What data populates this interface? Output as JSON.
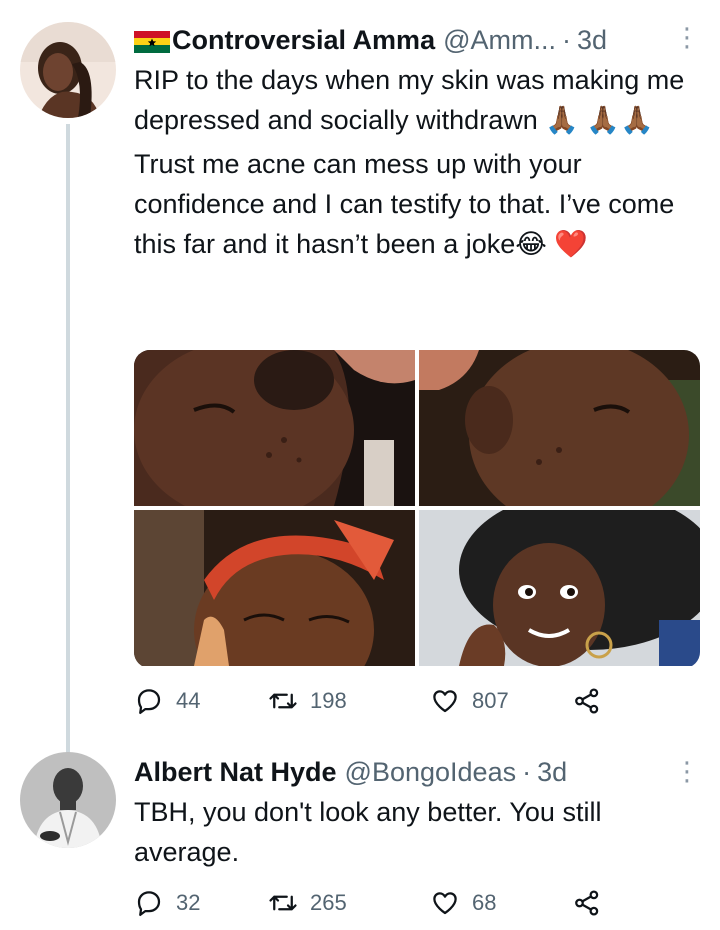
{
  "tweet1": {
    "display_name": "Controversial Amma",
    "handle": "@Amm...",
    "separator": "·",
    "time": "3d",
    "paragraph1": "RIP to the days when my skin was making me depressed and socially withdrawn 🙏🏾 🙏🏾🙏🏾",
    "paragraph2": "Trust me acne can mess up with your confidence and I can testify to that. I’ve come this far and it hasn’t been a joke😂 ❤️",
    "reply_count": "44",
    "retweet_count": "198",
    "like_count": "807",
    "icons": {
      "reply": "reply-icon",
      "retweet": "retweet-icon",
      "like": "heart-icon",
      "share": "share-icon",
      "more": "more-icon",
      "flag": "ghana-flag-icon"
    },
    "colors": {
      "flag_red": "#ce1126",
      "flag_yellow": "#fcd116",
      "flag_green": "#006b3f"
    }
  },
  "tweet2": {
    "display_name": "Albert Nat Hyde",
    "handle": "@BongoIdeas",
    "separator": "·",
    "time": "3d",
    "text": "TBH, you don't look any better. You still average.",
    "reply_count": "32",
    "retweet_count": "265",
    "like_count": "68"
  },
  "colors": {
    "text": "#0f1419",
    "secondary": "#536471",
    "thread_line": "#cfd9de"
  }
}
